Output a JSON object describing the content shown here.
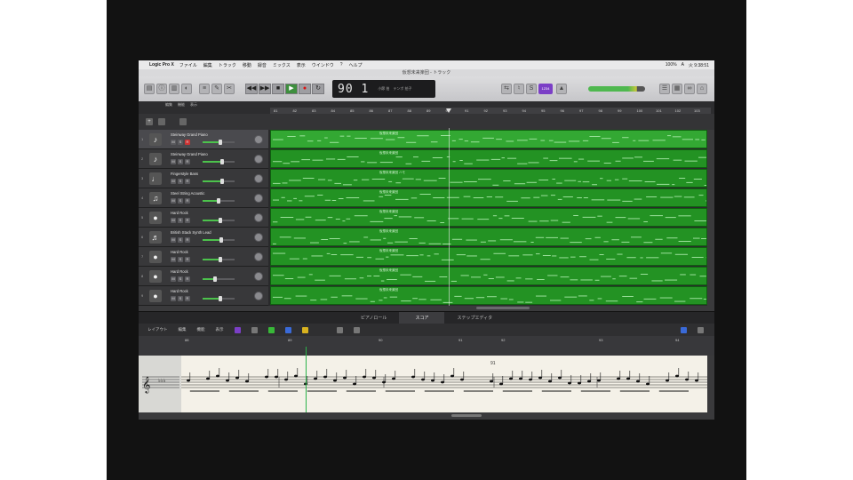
{
  "menubar": {
    "app_name": "Logic Pro X",
    "items": [
      "ファイル",
      "編集",
      "トラック",
      "移動",
      "録音",
      "ミックス",
      "表示",
      "ウインドウ",
      "?",
      "ヘルプ"
    ],
    "status": [
      "100%",
      "A",
      "火 9:38:51"
    ]
  },
  "titlebar": {
    "title": "仮想未来楽団 - トラック"
  },
  "lcd": {
    "position": "90 1",
    "labels_top": "小節 拍",
    "labels_bottom": "テンポ 拍子"
  },
  "controlbar": {
    "purple_label": "1234"
  },
  "toolstrip": [
    "編集",
    "機能",
    "表示"
  ],
  "ruler": [
    "81",
    "82",
    "83",
    "84",
    "85",
    "86",
    "87",
    "88",
    "89",
    "90",
    "91",
    "92",
    "93",
    "94",
    "95",
    "96",
    "97",
    "98",
    "99",
    "100",
    "101",
    "102",
    "103"
  ],
  "tracks": [
    {
      "num": "1",
      "name": "Steinway Grand Piano",
      "icon": "piano-icon",
      "glyph": "♪",
      "selected": true,
      "fader": 0.55
    },
    {
      "num": "2",
      "name": "Steinway Grand Piano",
      "icon": "piano-icon",
      "glyph": "♪",
      "selected": false,
      "fader": 0.62
    },
    {
      "num": "3",
      "name": "Fingerstyle Bass",
      "icon": "bass-guitar-icon",
      "glyph": "♩",
      "selected": false,
      "fader": 0.6
    },
    {
      "num": "4",
      "name": "Steel String Acoustic",
      "icon": "acoustic-guitar-icon",
      "glyph": "♫",
      "selected": false,
      "fader": 0.5
    },
    {
      "num": "5",
      "name": "Hard Rock",
      "icon": "drum-icon",
      "glyph": "●",
      "selected": false,
      "fader": 0.55
    },
    {
      "num": "6",
      "name": "British Stack Synth Lead",
      "icon": "synth-icon",
      "glyph": "♬",
      "selected": false,
      "fader": 0.58
    },
    {
      "num": "7",
      "name": "Hard Rock",
      "icon": "drum-icon",
      "glyph": "●",
      "selected": false,
      "fader": 0.55
    },
    {
      "num": "8",
      "name": "Hard Rock",
      "icon": "drum-icon",
      "glyph": "●",
      "selected": false,
      "fader": 0.4
    },
    {
      "num": "9",
      "name": "Hard Rock",
      "icon": "drum-icon",
      "glyph": "●",
      "selected": false,
      "fader": 0.55
    }
  ],
  "regions": [
    "仮想未来楽団",
    "仮想未来楽団",
    "仮想未来楽団 ハモ",
    "仮想未来楽団",
    "仮想未来楽団",
    "仮想未来楽団",
    "仮想未来楽団",
    "仮想未来楽団",
    "仮想未来楽団"
  ],
  "editor": {
    "tabs": [
      "ピアノロール",
      "スコア",
      "ステップエディタ"
    ],
    "active_tab": "スコア",
    "toolbar": [
      "レイアウト",
      "編集",
      "機能",
      "表示"
    ],
    "ruler": [
      "88",
      "89",
      "90",
      "91",
      "92",
      "93",
      "94"
    ],
    "measure_label": "91"
  },
  "colors": {
    "region_green": "#239223",
    "playhead": "#2bb34a",
    "accent_purple": "#7b3fc6"
  }
}
